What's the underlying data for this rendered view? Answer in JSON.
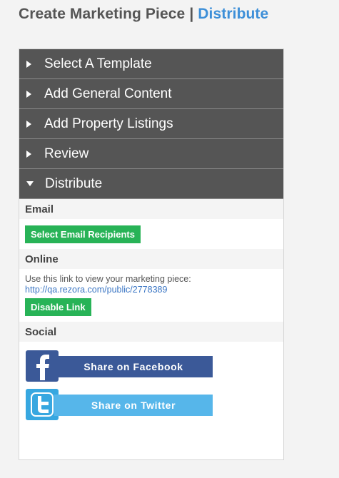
{
  "header": {
    "title": "Create Marketing Piece",
    "separator": "|",
    "current_step": "Distribute"
  },
  "accordion": {
    "items": [
      {
        "label": "Select A Template",
        "expanded": false
      },
      {
        "label": "Add General Content",
        "expanded": false
      },
      {
        "label": "Add Property Listings",
        "expanded": false
      },
      {
        "label": "Review",
        "expanded": false
      },
      {
        "label": "Distribute",
        "expanded": true
      }
    ]
  },
  "distribute": {
    "email": {
      "label": "Email",
      "button_label": "Select Email Recipients"
    },
    "online": {
      "label": "Online",
      "description": "Use this link to view your marketing piece:",
      "link": "http://qa.rezora.com/public/2778389",
      "button_label": "Disable Link"
    },
    "social": {
      "label": "Social",
      "facebook_label": "Share on Facebook",
      "twitter_label": "Share on Twitter"
    }
  },
  "colors": {
    "accordion_bg": "#555555",
    "accent_blue": "#3d8fd8",
    "button_green": "#28b357",
    "facebook_blue": "#3b5998",
    "twitter_blue": "#56b6ea"
  },
  "icons": {
    "collapsed": "caret-right-icon",
    "expanded": "caret-down-icon",
    "facebook": "facebook-icon",
    "twitter": "twitter-icon"
  }
}
